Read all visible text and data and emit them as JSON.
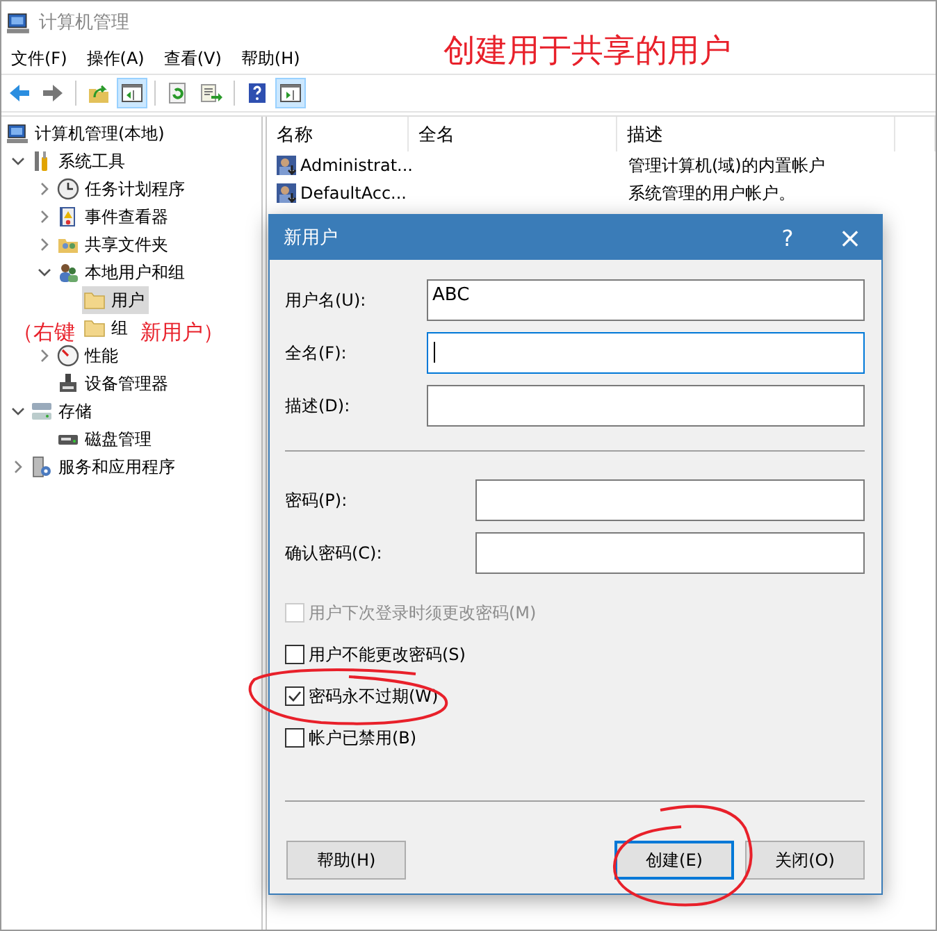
{
  "window": {
    "title": "计算机管理"
  },
  "menu": [
    "文件(F)",
    "操作(A)",
    "查看(V)",
    "帮助(H)"
  ],
  "toolbar": {
    "groups": [
      [
        {
          "kind": "back",
          "pressed": false
        },
        {
          "kind": "forward",
          "pressed": false
        }
      ],
      [
        {
          "kind": "up",
          "pressed": false
        },
        {
          "kind": "console-tree",
          "pressed": true
        }
      ],
      [
        {
          "kind": "refresh",
          "pressed": false
        },
        {
          "kind": "export",
          "pressed": false
        }
      ],
      [
        {
          "kind": "help",
          "pressed": false
        },
        {
          "kind": "action-pane",
          "pressed": true
        }
      ]
    ]
  },
  "tree": {
    "items": [
      {
        "label": "计算机管理(本地)",
        "kind": "computer",
        "selected": false,
        "children": [
          {
            "label": "系统工具",
            "kind": "tools",
            "selected": false,
            "expanded": true,
            "children": [
              {
                "label": "任务计划程序",
                "kind": "scheduler",
                "selected": false,
                "expanded": false
              },
              {
                "label": "事件查看器",
                "kind": "events",
                "selected": false,
                "expanded": false
              },
              {
                "label": "共享文件夹",
                "kind": "shared",
                "selected": false,
                "expanded": false
              },
              {
                "label": "本地用户和组",
                "kind": "users",
                "selected": false,
                "expanded": true,
                "children": [
                  {
                    "label": "用户",
                    "kind": "folder",
                    "selected": true
                  },
                  {
                    "label": "组",
                    "kind": "folder",
                    "selected": false
                  }
                ]
              },
              {
                "label": "性能",
                "kind": "performance",
                "selected": false,
                "expanded": false
              },
              {
                "label": "设备管理器",
                "kind": "device",
                "selected": false
              }
            ]
          },
          {
            "label": "存储",
            "kind": "storage",
            "selected": false,
            "expanded": true,
            "children": [
              {
                "label": "磁盘管理",
                "kind": "disk",
                "selected": false
              }
            ]
          },
          {
            "label": "服务和应用程序",
            "kind": "services",
            "selected": false,
            "expanded": false
          }
        ]
      }
    ]
  },
  "list": {
    "columns": [
      "名称",
      "全名",
      "描述"
    ],
    "rows": [
      {
        "name": "Administrat...",
        "description": "管理计算机(域)的内置帐户"
      },
      {
        "name": "DefaultAcc...",
        "description": "系统管理的用户帐户。"
      }
    ]
  },
  "dialog": {
    "title": "新用户",
    "help_glyph": "?",
    "close_glyph": "×",
    "identity_fields": [
      {
        "label": "用户名(U):",
        "value": "ABC",
        "focused": false
      },
      {
        "label": "全名(F):",
        "focused": true
      },
      {
        "label": "描述(D):",
        "focused": false
      }
    ],
    "password_fields": [
      {
        "label": "密码(P):",
        "focused": false
      },
      {
        "label": "确认密码(C):",
        "focused": false
      }
    ],
    "checkboxes": [
      {
        "label": "用户下次登录时须更改密码(M)",
        "checked": false,
        "disabled": true
      },
      {
        "label": "用户不能更改密码(S)",
        "checked": false,
        "disabled": false
      },
      {
        "label": "密码永不过期(W)",
        "checked": true,
        "disabled": false
      },
      {
        "label": "帐户已禁用(B)",
        "checked": false,
        "disabled": false
      }
    ],
    "buttons": [
      {
        "label": "帮助(H)",
        "default": false
      },
      {
        "label": "创建(E)",
        "default": true
      },
      {
        "label": "关闭(O)",
        "default": false
      }
    ]
  },
  "annotations": {
    "heading": "创建用于共享的用户",
    "note": [
      "（右键",
      "新用户）"
    ]
  }
}
